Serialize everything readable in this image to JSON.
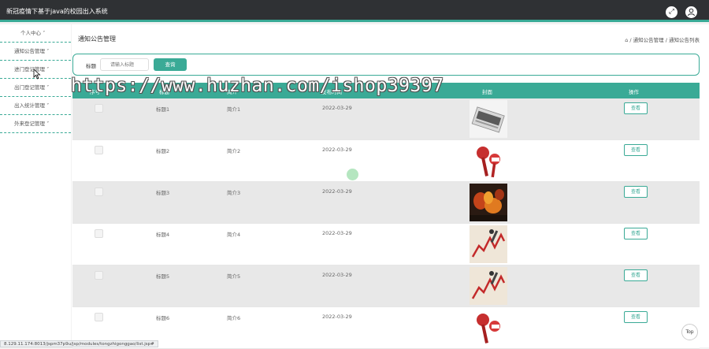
{
  "app": {
    "title": "新冠疫情下基于java的校园出入系统"
  },
  "topbar_icons": [
    "fullscreen-icon",
    "user-icon"
  ],
  "sidebar": {
    "items": [
      {
        "label": "个人中心",
        "caret": "˅"
      },
      {
        "label": "通知公告管理",
        "caret": "˅"
      },
      {
        "label": "进门登记管理",
        "caret": "˅"
      },
      {
        "label": "出门登记管理",
        "caret": "˅"
      },
      {
        "label": "出入统计管理",
        "caret": "˅"
      },
      {
        "label": "外来登记管理",
        "caret": "˅"
      }
    ]
  },
  "page": {
    "heading": "通知公告管理",
    "breadcrumb": "/ 通知公告管理 / 通知公告列表"
  },
  "search": {
    "label": "标题",
    "placeholder": "请输入标题",
    "button": "查询"
  },
  "table": {
    "columns": [
      "序号",
      "标题",
      "简介",
      "发布时间",
      "封面",
      "操作"
    ],
    "view_label": "查看",
    "rows": [
      {
        "title": "标题1",
        "summary": "简介1",
        "date": "2022-03-29",
        "cover": "news-image"
      },
      {
        "title": "标题2",
        "summary": "简介2",
        "date": "2022-03-29",
        "cover": "microphone-image"
      },
      {
        "title": "标题3",
        "summary": "简介3",
        "date": "2022-03-29",
        "cover": "fire-image"
      },
      {
        "title": "标题4",
        "summary": "简介4",
        "date": "2022-03-29",
        "cover": "market-chart-image"
      },
      {
        "title": "标题5",
        "summary": "简介5",
        "date": "2022-03-29",
        "cover": "market-chart-image"
      },
      {
        "title": "标题6",
        "summary": "简介6",
        "date": "2022-03-29",
        "cover": "microphone-image"
      }
    ]
  },
  "watermark": "https://www.huzhan.com/ishop39397",
  "statusbar": "8.129.11.174:8013/jspm37p9u/jsp/modules/tongzhigonggao/list.jsp#",
  "top_button": "Top",
  "colors": {
    "accent": "#3aaa96",
    "topbar": "#2f3134"
  }
}
